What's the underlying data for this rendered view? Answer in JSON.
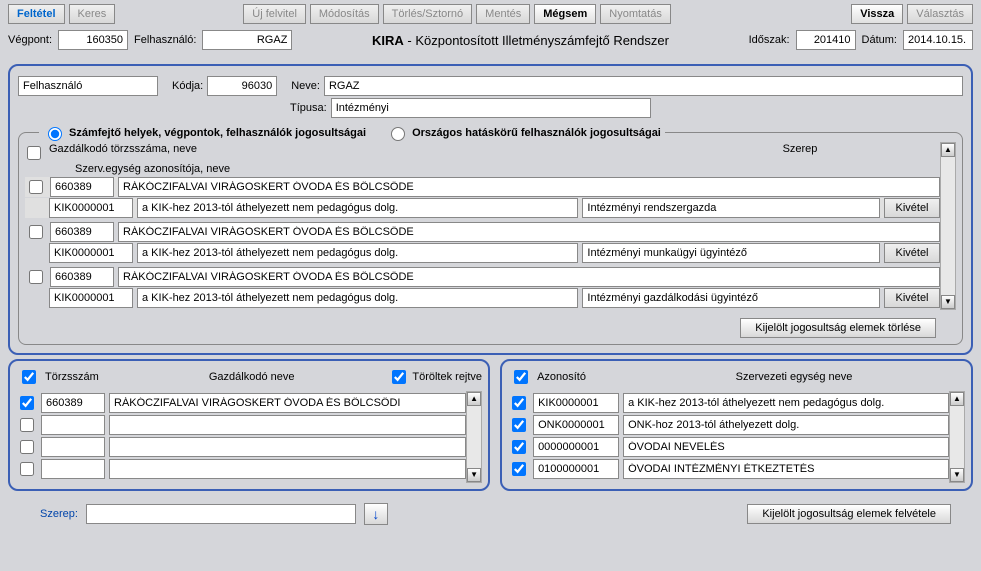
{
  "toolbar": {
    "feltetel": "Feltétel",
    "keres": "Keres",
    "uj_felvitel": "Új felvitel",
    "modositas": "Módosítás",
    "torles": "Törlés/Sztornó",
    "mentes": "Mentés",
    "megsem": "Mégsem",
    "nyomtatas": "Nyomtatás",
    "vissza": "Vissza",
    "valasztas": "Választás"
  },
  "info": {
    "vegpont_lbl": "Végpont:",
    "vegpont_val": "160350",
    "felhasz_lbl": "Felhasználó:",
    "felhasz_val": "RGAZ",
    "app_title_strong": "KIRA",
    "app_title_rest": " - Központosított Illetményszámfejtő Rendszer",
    "idoszak_lbl": "Időszak:",
    "idoszak_val": "201410",
    "datum_lbl": "Dátum:",
    "datum_val": "2014.10.15."
  },
  "user": {
    "title": "Felhasználó",
    "kodja_lbl": "Kódja:",
    "kodja_val": "96030",
    "neve_lbl": "Neve:",
    "neve_val": "RGAZ",
    "tipusa_lbl": "Típusa:",
    "tipusa_val": "Intézményi"
  },
  "perms": {
    "radio1": "Számfejtő helyek, végpontok, felhasználók jogosultságai",
    "radio2": "Országos hatáskörű felhasználók jogosultságai",
    "hdr_col1": "Gazdálkodó törzsszáma, neve",
    "hdr_col2": "Szerv.egység azonosítója, neve",
    "hdr_col3": "Szerep",
    "kivetel": "Kivétel",
    "delete_btn": "Kijelölt jogosultság elemek törlése",
    "rows": [
      {
        "torzs": "660389",
        "torzs_nev": "RÁKÓCZIFALVAI VIRÁGOSKERT ÓVODA ÉS BÖLCSŐDE",
        "azon": "KIK0000001",
        "azon_nev": "a KIK-hez 2013-tól áthelyezett nem pedagógus dolg.",
        "szerep": "Intézményi rendszergazda"
      },
      {
        "torzs": "660389",
        "torzs_nev": "RÁKÓCZIFALVAI VIRÁGOSKERT ÓVODA ÉS BÖLCSŐDE",
        "azon": "KIK0000001",
        "azon_nev": "a KIK-hez 2013-tól áthelyezett nem pedagógus dolg.",
        "szerep": "Intézményi munkaügyi ügyintéző"
      },
      {
        "torzs": "660389",
        "torzs_nev": "RÁKÓCZIFALVAI VIRÁGOSKERT ÓVODA ÉS BÖLCSŐDE",
        "azon": "KIK0000001",
        "azon_nev": "a KIK-hez 2013-tól áthelyezett nem pedagógus dolg.",
        "szerep": "Intézményi gazdálkodási ügyintéző"
      }
    ]
  },
  "left_list": {
    "hdr_torzs": "Törzsszám",
    "hdr_nev": "Gazdálkodó neve",
    "toroltek": "Töröltek rejtve",
    "rows": [
      {
        "torzs": "660389",
        "nev": "RÁKÓCZIFALVAI VIRÁGOSKERT ÓVODA ÉS BÖLCSÖDI"
      },
      {
        "torzs": "",
        "nev": ""
      },
      {
        "torzs": "",
        "nev": ""
      },
      {
        "torzs": "",
        "nev": ""
      }
    ]
  },
  "right_list": {
    "hdr_azon": "Azonosító",
    "hdr_nev": "Szervezeti egység neve",
    "rows": [
      {
        "azon": "KIK0000001",
        "nev": "a KIK-hez 2013-tól áthelyezett nem pedagógus dolg."
      },
      {
        "azon": "ONK0000001",
        "nev": "ONK-hoz 2013-tól áthelyezett dolg."
      },
      {
        "azon": "0000000001",
        "nev": "ÓVODAI NEVELÉS"
      },
      {
        "azon": "0100000001",
        "nev": "ÓVODAI INTÉZMÉNYI ÉTKEZTETÉS"
      }
    ]
  },
  "bottom": {
    "szerep_lbl": "Szerep:",
    "szerep_val": "",
    "add_btn": "Kijelölt jogosultság elemek felvétele"
  }
}
